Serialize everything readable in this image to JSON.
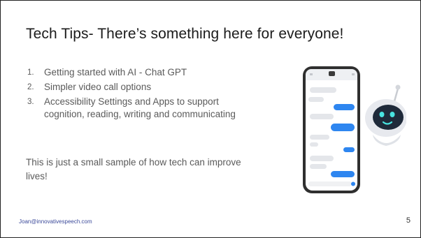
{
  "slide": {
    "title": "Tech Tips- There’s something here for everyone!",
    "items": [
      {
        "num": "1.",
        "text": "Getting started with AI - Chat GPT"
      },
      {
        "num": "2.",
        "text": "Simpler video call options"
      },
      {
        "num": "3.",
        "text": "Accessibility Settings and Apps to support cognition, reading, writing and communicating"
      }
    ],
    "tagline": "This is just a small sample of how tech can improve lives!",
    "footer_email": "Joan@innovativespeech.com",
    "page_number": "5"
  },
  "illustration": {
    "icons": [
      "smartphone-icon",
      "chatbot-robot-icon"
    ],
    "colors": {
      "phone_frame": "#2f2f2f",
      "bubble_blue": "#2e86f0",
      "bubble_gray": "#e4e6ea",
      "robot_face": "#1f2a3a",
      "robot_eyes": "#49e3e0"
    }
  }
}
